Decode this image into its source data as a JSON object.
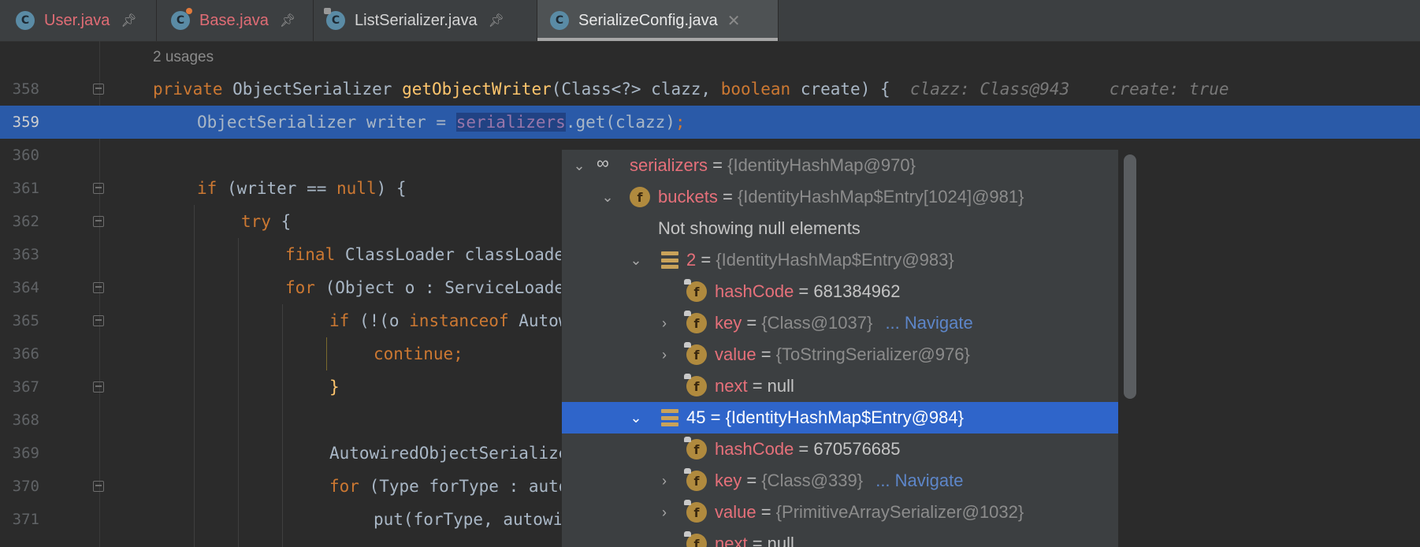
{
  "tabs": [
    {
      "label": "User.java",
      "color": "#e06c75",
      "pinned": true,
      "icon": "class-icon"
    },
    {
      "label": "Base.java",
      "color": "#e06c75",
      "pinned": true,
      "icon": "class-icon"
    },
    {
      "label": "ListSerializer.java",
      "color": "#c5c5c5",
      "pinned": true,
      "icon": "class-icon"
    },
    {
      "label": "SerializeConfig.java",
      "color": "#c5c5c5",
      "pinned": false,
      "active": true,
      "icon": "class-icon"
    }
  ],
  "editor": {
    "usages": "2 usages",
    "lines": [
      {
        "num": "358"
      },
      {
        "num": "359"
      },
      {
        "num": "360"
      },
      {
        "num": "361"
      },
      {
        "num": "362"
      },
      {
        "num": "363"
      },
      {
        "num": "364"
      },
      {
        "num": "365"
      },
      {
        "num": "366"
      },
      {
        "num": "367"
      },
      {
        "num": "368"
      },
      {
        "num": "369"
      },
      {
        "num": "370"
      },
      {
        "num": "371"
      }
    ],
    "hint_clazz": "clazz: Class@943",
    "hint_create": "create: true"
  },
  "debug_popup": {
    "rows": [
      {
        "name": "serializers",
        "eq": " = ",
        "value": "{IdentityHashMap@970}"
      },
      {
        "name": "buckets",
        "eq": " = ",
        "value": "{IdentityHashMap$Entry[1024]@981}"
      },
      {
        "text": "Not showing null elements"
      },
      {
        "name": "2",
        "eq": " = ",
        "value": "{IdentityHashMap$Entry@983}"
      },
      {
        "name": "hashCode",
        "eq": " = ",
        "value": "681384962"
      },
      {
        "name": "key",
        "eq": " = ",
        "value": "{Class@1037}",
        "nav": "... Navigate"
      },
      {
        "name": "value",
        "eq": " = ",
        "value": "{ToStringSerializer@976}"
      },
      {
        "name": "next",
        "eq": " = ",
        "value": "null"
      },
      {
        "name": "45",
        "eq": " = ",
        "value": "{IdentityHashMap$Entry@984}"
      },
      {
        "name": "hashCode",
        "eq": " = ",
        "value": "670576685"
      },
      {
        "name": "key",
        "eq": " = ",
        "value": "{Class@339}",
        "nav": "... Navigate"
      },
      {
        "name": "value",
        "eq": " = ",
        "value": "{PrimitiveArraySerializer@1032}"
      },
      {
        "name": "next",
        "eq": " = ",
        "value": "null"
      }
    ]
  }
}
